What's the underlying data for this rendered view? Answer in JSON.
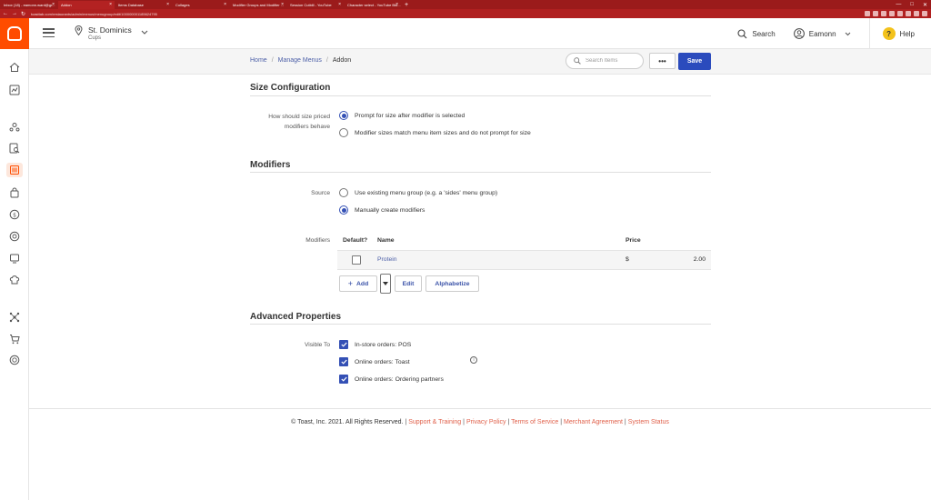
{
  "browser": {
    "tabs": [
      {
        "label": "Inbox (18) - eamonn.ward@gr...",
        "active": false
      },
      {
        "label": "Addon",
        "active": true
      },
      {
        "label": "Items Database",
        "active": false
      },
      {
        "label": "Collages",
        "active": false
      },
      {
        "label": "Modifier Groups and Modifier ...",
        "active": false
      },
      {
        "label": "Session Cutbill - YouTube",
        "active": false
      },
      {
        "label": "Character select - YouTube Blu...",
        "active": false
      }
    ],
    "new_tab": "+",
    "url": "toasttab.com/restaurants/admin/menus/menugroup/edit/100000001185624795"
  },
  "topbar": {
    "location_name": "St. Dominics",
    "location_sub": "Cups",
    "search_label": "Search",
    "user_name": "Eamonn",
    "help_label": "Help",
    "help_icon_text": "?"
  },
  "breadcrumb": {
    "home": "Home",
    "manage_menus": "Manage Menus",
    "current": "Addon",
    "separator": "/"
  },
  "toolbar": {
    "search_placeholder": "Search Items",
    "more_label": "•••",
    "save_label": "Save"
  },
  "size_config": {
    "title": "Size Configuration",
    "question": "How should size priced modifiers behave",
    "options": [
      {
        "label": "Prompt for size after modifier is selected",
        "selected": true
      },
      {
        "label": "Modifier sizes match menu item sizes and do not prompt for size",
        "selected": false
      }
    ]
  },
  "modifiers": {
    "title": "Modifiers",
    "source_label": "Source",
    "source_options": [
      {
        "label": "Use existing menu group (e.g. a 'sides' menu group)",
        "selected": false
      },
      {
        "label": "Manually create modifiers",
        "selected": true
      }
    ],
    "table_label": "Modifiers",
    "columns": {
      "default": "Default?",
      "name": "Name",
      "price": "Price"
    },
    "rows": [
      {
        "default": false,
        "name": "Protein",
        "currency": "$",
        "price": "2.00"
      }
    ],
    "add_label": "Add",
    "add_plus": "+",
    "edit_label": "Edit",
    "alphabetize_label": "Alphabetize"
  },
  "advanced": {
    "title": "Advanced Properties",
    "visible_label": "Visible To",
    "options": [
      {
        "label": "In-store orders: POS",
        "checked": true
      },
      {
        "label": "Online orders: Toast",
        "checked": true
      },
      {
        "label": "Online orders: Ordering partners",
        "checked": true
      }
    ],
    "info_icon_text": "i"
  },
  "footer": {
    "copyright": "© Toast, Inc. 2021. All Rights Reserved.",
    "separator": "|",
    "links": [
      "Support & Training",
      "Privacy Policy",
      "Terms of Service",
      "Merchant Agreement",
      "System Status"
    ]
  },
  "colors": {
    "brand": "#ff4c00",
    "primary": "#2b4bbd",
    "link": "#4d60a8",
    "footer_link": "#e0604a",
    "browser_chrome": "#9b1b1b"
  }
}
